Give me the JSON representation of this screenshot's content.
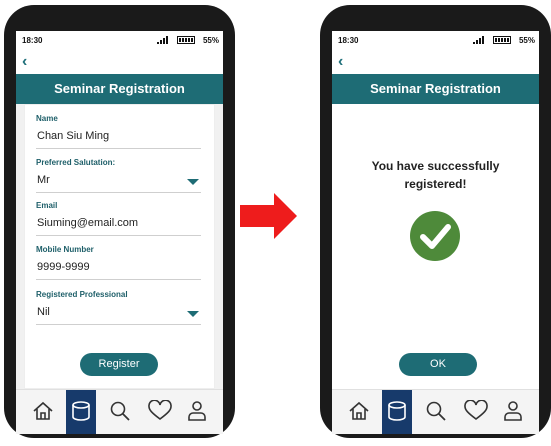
{
  "status_bar": {
    "time": "18:30",
    "battery": "55%"
  },
  "left_screen": {
    "title": "Seminar Registration",
    "fields": [
      {
        "label": "Name",
        "value": "Chan Siu Ming"
      },
      {
        "label": "Preferred Salutation:",
        "value": "Mr"
      },
      {
        "label": "Email",
        "value": "Siuming@email.com"
      },
      {
        "label": "Mobile Number",
        "value": "9999-9999"
      },
      {
        "label": "Registered Professional",
        "value": "Nil"
      }
    ],
    "register_label": "Register"
  },
  "right_screen": {
    "title": "Seminar Registration",
    "message_line1": "You have successfully",
    "message_line2": "registered!",
    "ok_label": "OK"
  },
  "nav_icons": [
    "home-icon",
    "database-icon",
    "search-icon",
    "heart-icon",
    "user-icon"
  ],
  "colors": {
    "accent": "#1e6c75",
    "nav_active": "#173a6b",
    "success": "#4e8a3a",
    "arrow": "#ee1c1c"
  }
}
